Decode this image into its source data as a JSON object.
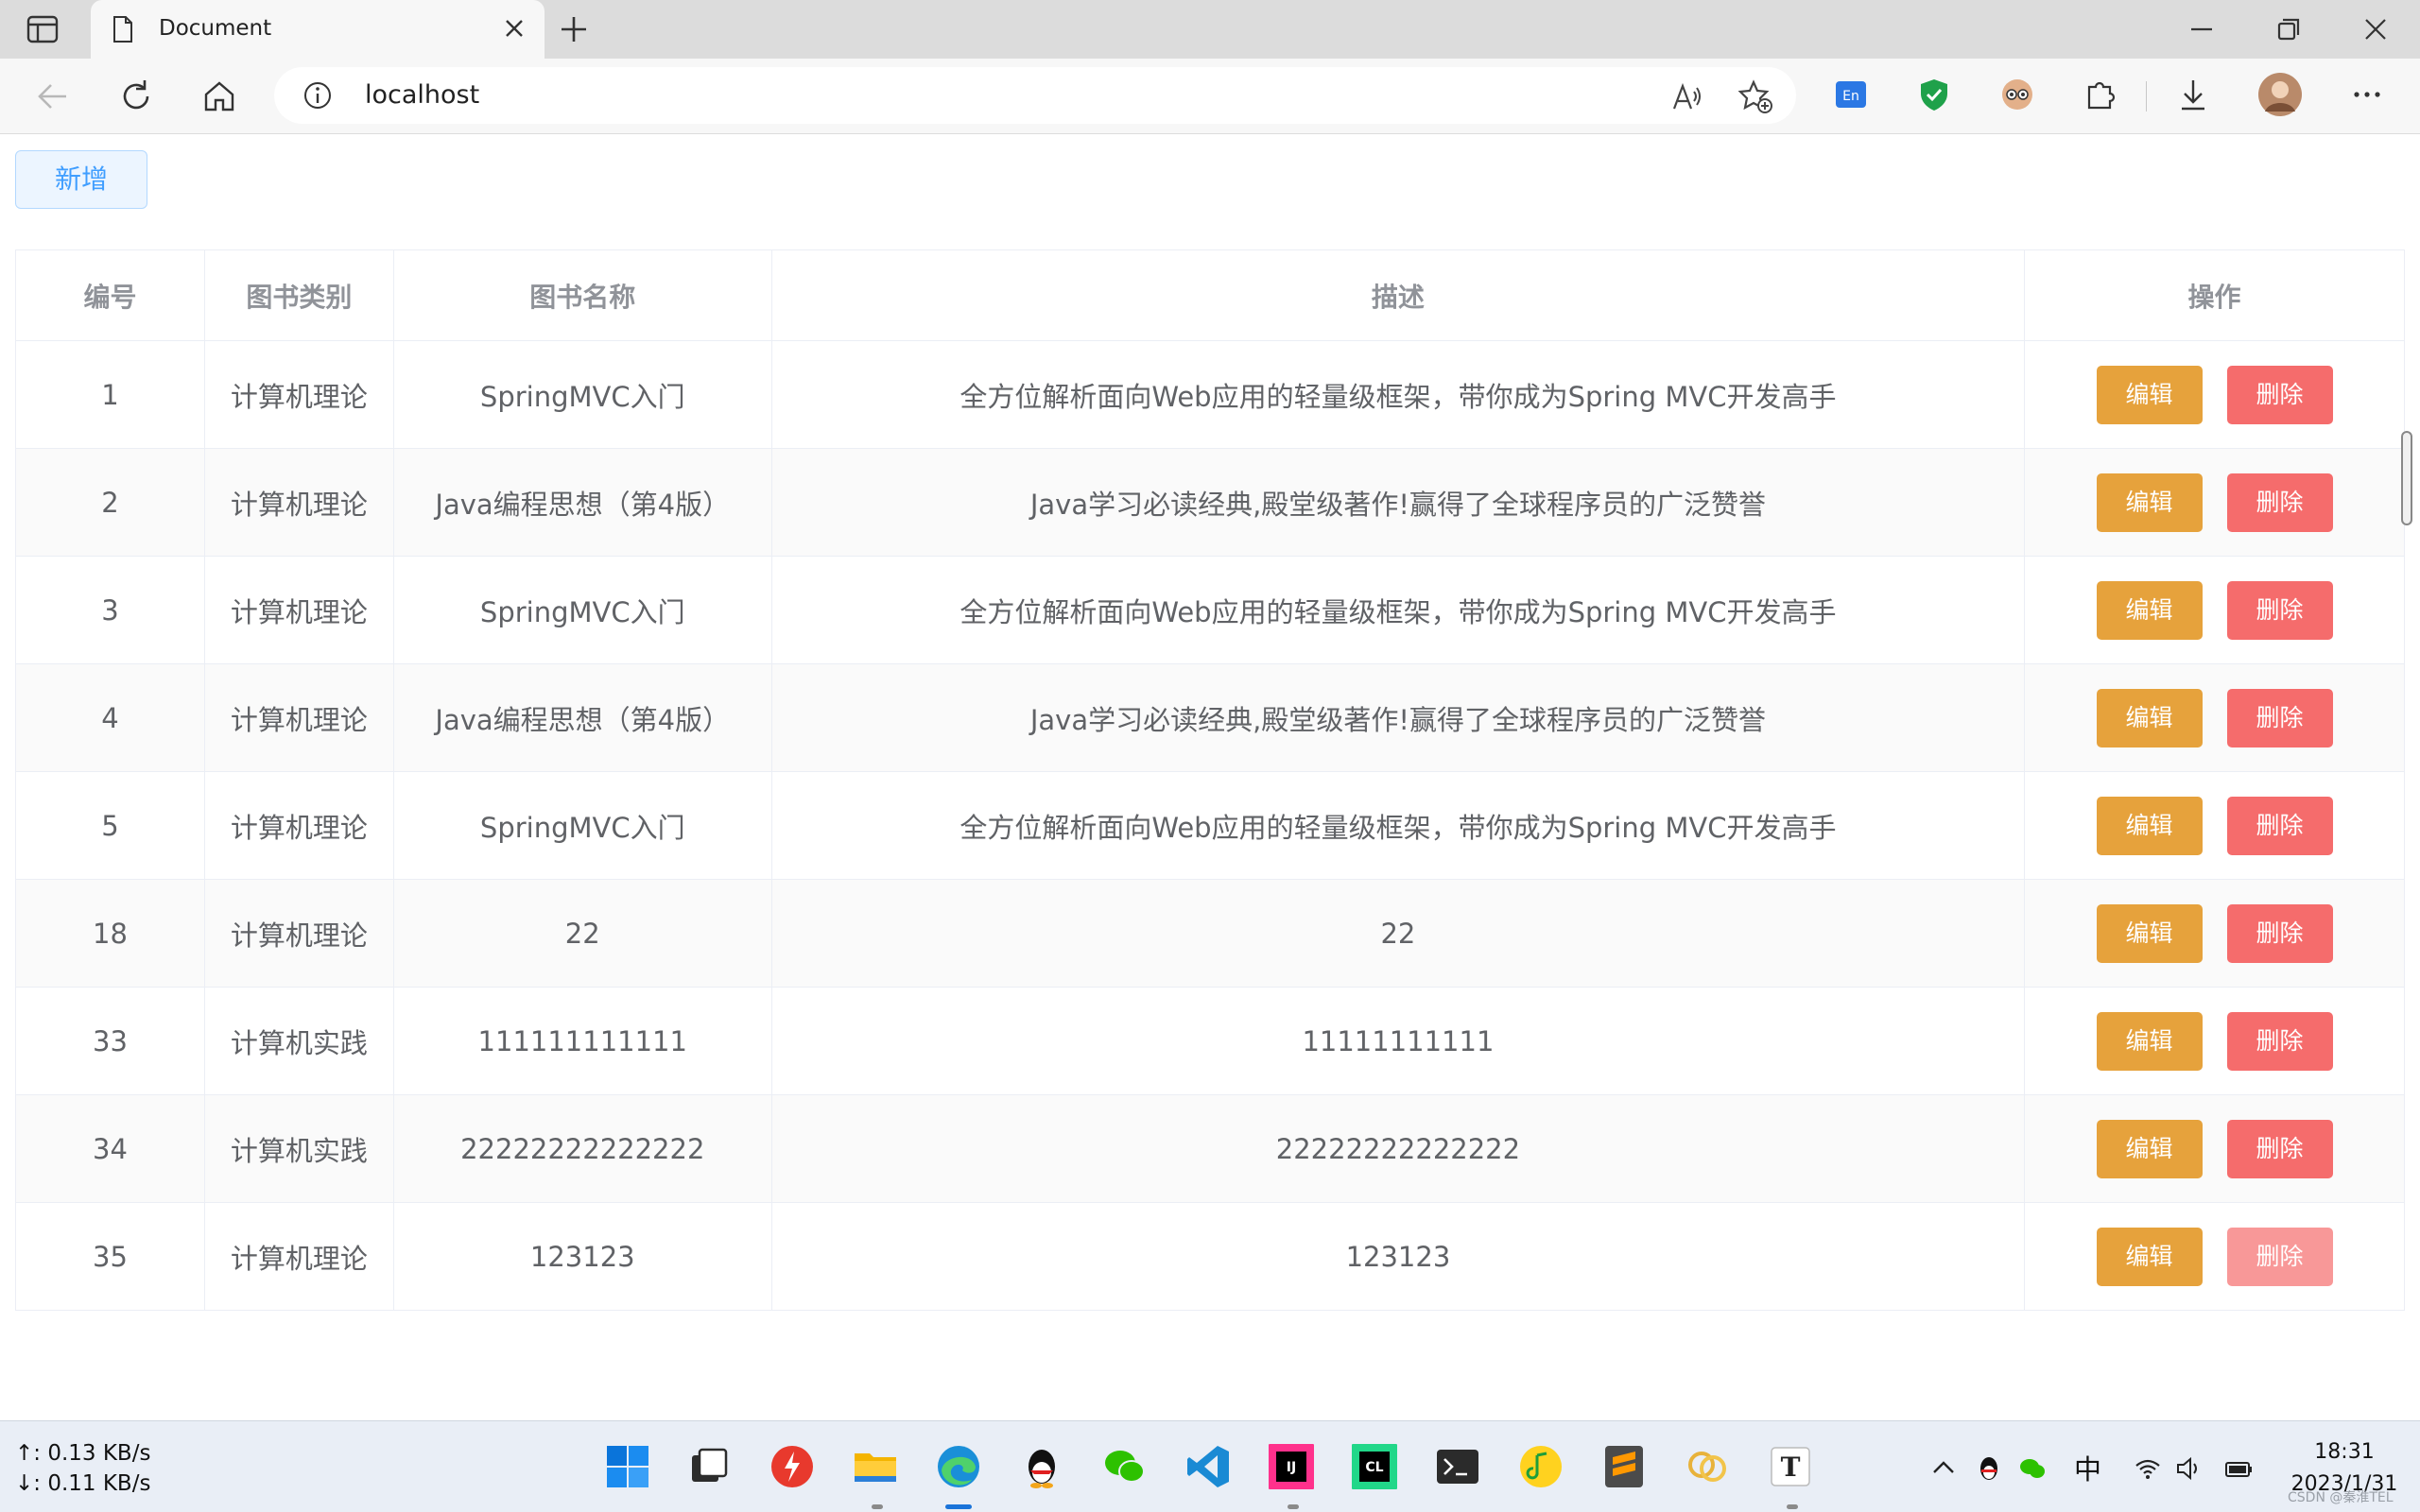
{
  "browser": {
    "tab_title": "Document",
    "url": "localhost"
  },
  "page": {
    "add_button_label": "新增",
    "columns": [
      "编号",
      "图书类别",
      "图书名称",
      "描述",
      "操作"
    ],
    "rows": [
      {
        "id": "1",
        "category": "计算机理论",
        "name": "SpringMVC入门",
        "description": "全方位解析面向Web应用的轻量级框架，带你成为Spring MVC开发高手"
      },
      {
        "id": "2",
        "category": "计算机理论",
        "name": "Java编程思想（第4版）",
        "description": "Java学习必读经典,殿堂级著作!赢得了全球程序员的广泛赞誉"
      },
      {
        "id": "3",
        "category": "计算机理论",
        "name": "SpringMVC入门",
        "description": "全方位解析面向Web应用的轻量级框架，带你成为Spring MVC开发高手"
      },
      {
        "id": "4",
        "category": "计算机理论",
        "name": "Java编程思想（第4版）",
        "description": "Java学习必读经典,殿堂级著作!赢得了全球程序员的广泛赞誉"
      },
      {
        "id": "5",
        "category": "计算机理论",
        "name": "SpringMVC入门",
        "description": "全方位解析面向Web应用的轻量级框架，带你成为Spring MVC开发高手"
      },
      {
        "id": "18",
        "category": "计算机理论",
        "name": "22",
        "description": "22"
      },
      {
        "id": "33",
        "category": "计算机实践",
        "name": "111111111111",
        "description": "11111111111"
      },
      {
        "id": "34",
        "category": "计算机实践",
        "name": "22222222222222",
        "description": "22222222222222"
      },
      {
        "id": "35",
        "category": "计算机理论",
        "name": "123123",
        "description": "123123"
      }
    ],
    "edit_label": "编辑",
    "delete_label": "删除"
  },
  "taskbar": {
    "upload_speed": "↑: 0.13 KB/s",
    "download_speed": "↓: 0.11 KB/s",
    "ime": "中",
    "time": "18:31",
    "date": "2023/1/31",
    "watermark": "CSDN @秦淮TEL"
  },
  "colors": {
    "edit_button": "#e6a23c",
    "delete_button": "#f56c6c",
    "add_button_text": "#409eff"
  }
}
